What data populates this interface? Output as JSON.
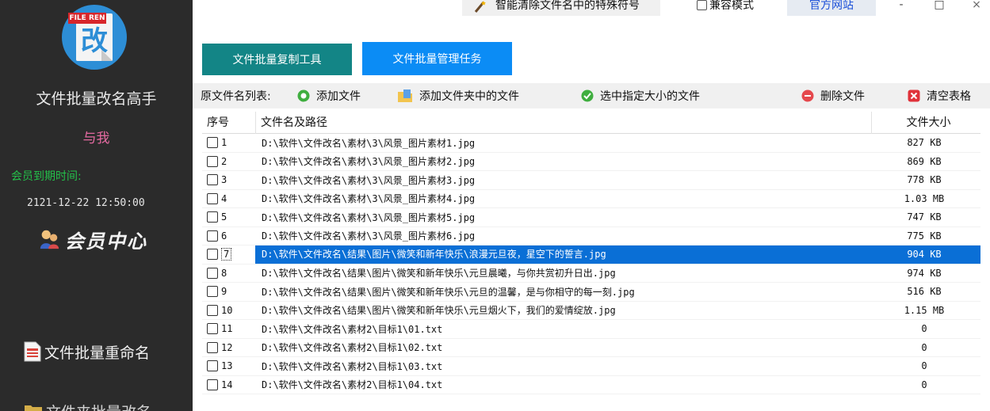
{
  "sidebar": {
    "logo_tag": "FILE REN",
    "logo_glyph": "改",
    "app_title": "文件批量改名高手",
    "user_name": "与我",
    "member_label": "会员到期时间:",
    "member_expiry": "2121-12-22 12:50:00",
    "member_center": "会员中心",
    "nav": [
      {
        "label": "文件批量重命名",
        "icon": "document-icon"
      },
      {
        "label": "文件夹批量改名",
        "icon": "folder-icon"
      }
    ]
  },
  "topbar": {
    "special_chars": "智能清除文件名中的特殊符号",
    "compat_mode": "兼容模式",
    "official_site": "官方网站",
    "minimize": "-",
    "maximize": "□",
    "close": "×"
  },
  "tool_tabs": {
    "copy_tool": "文件批量复制工具",
    "manage_task": "文件批量管理任务"
  },
  "toolbar": {
    "list_label": "原文件名列表:",
    "add_file": "添加文件",
    "add_folder_files": "添加文件夹中的文件",
    "select_by_size": "选中指定大小的文件",
    "delete_file": "删除文件",
    "clear_table": "清空表格"
  },
  "colors": {
    "sidebar_bg": "#2b2b2b",
    "tab_copy": "#138586",
    "tab_manage": "#0b8cf5",
    "selection": "#0a6fd6",
    "member_green": "#24c04a",
    "user_pink": "#e36aa0"
  },
  "table": {
    "columns": [
      "序号",
      "文件名及路径",
      "文件大小"
    ],
    "selected_row": 7,
    "rows": [
      {
        "num": "1",
        "path": "D:\\软件\\文件改名\\素材\\3\\风景_图片素材1.jpg",
        "size": "827 KB"
      },
      {
        "num": "2",
        "path": "D:\\软件\\文件改名\\素材\\3\\风景_图片素材2.jpg",
        "size": "869 KB"
      },
      {
        "num": "3",
        "path": "D:\\软件\\文件改名\\素材\\3\\风景_图片素材3.jpg",
        "size": "778 KB"
      },
      {
        "num": "4",
        "path": "D:\\软件\\文件改名\\素材\\3\\风景_图片素材4.jpg",
        "size": "1.03 MB"
      },
      {
        "num": "5",
        "path": "D:\\软件\\文件改名\\素材\\3\\风景_图片素材5.jpg",
        "size": "747 KB"
      },
      {
        "num": "6",
        "path": "D:\\软件\\文件改名\\素材\\3\\风景_图片素材6.jpg",
        "size": "775 KB"
      },
      {
        "num": "7",
        "path": "D:\\软件\\文件改名\\结果\\图片\\微笑和新年快乐\\浪漫元旦夜，星空下的誓言.jpg",
        "size": "904 KB"
      },
      {
        "num": "8",
        "path": "D:\\软件\\文件改名\\结果\\图片\\微笑和新年快乐\\元旦晨曦，与你共赏初升日出.jpg",
        "size": "974 KB"
      },
      {
        "num": "9",
        "path": "D:\\软件\\文件改名\\结果\\图片\\微笑和新年快乐\\元旦的温馨，是与你相守的每一刻.jpg",
        "size": "516 KB"
      },
      {
        "num": "10",
        "path": "D:\\软件\\文件改名\\结果\\图片\\微笑和新年快乐\\元旦烟火下，我们的爱情绽放.jpg",
        "size": "1.15 MB"
      },
      {
        "num": "11",
        "path": "D:\\软件\\文件改名\\素材2\\目标1\\01.txt",
        "size": "0"
      },
      {
        "num": "12",
        "path": "D:\\软件\\文件改名\\素材2\\目标1\\02.txt",
        "size": "0"
      },
      {
        "num": "13",
        "path": "D:\\软件\\文件改名\\素材2\\目标1\\03.txt",
        "size": "0"
      },
      {
        "num": "14",
        "path": "D:\\软件\\文件改名\\素材2\\目标1\\04.txt",
        "size": "0"
      }
    ]
  }
}
